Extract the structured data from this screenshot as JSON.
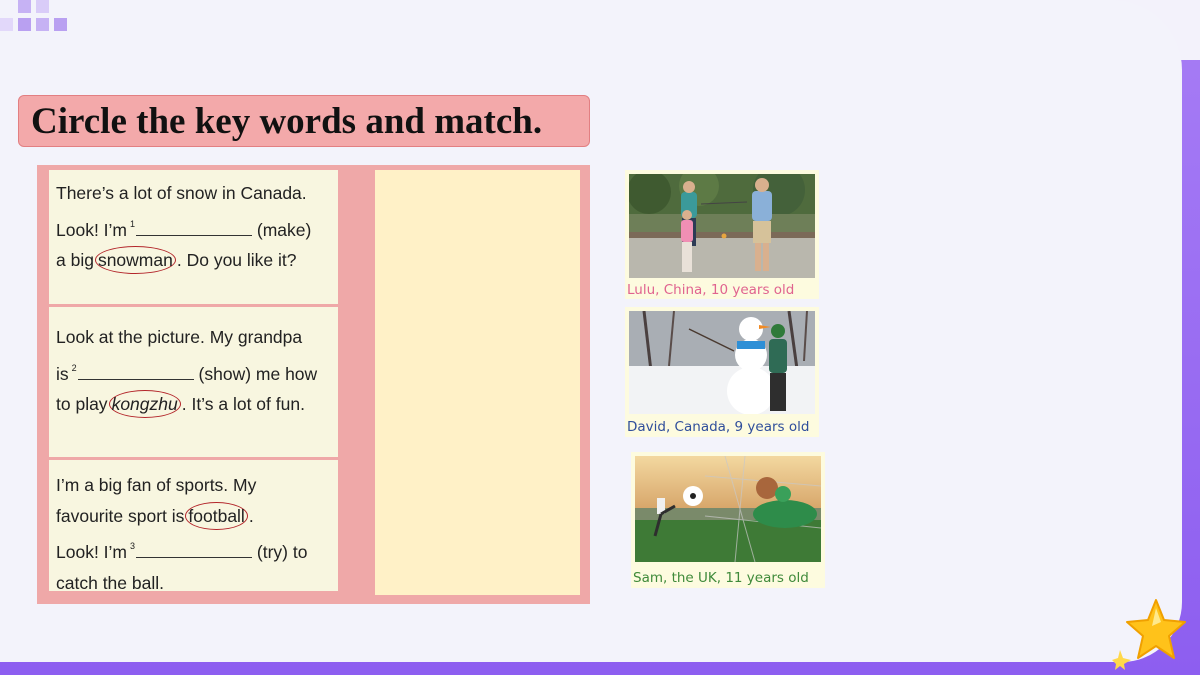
{
  "title": "Circle the key words and match.",
  "paragraphs": [
    {
      "line1": "There’s a lot of snow in Canada.",
      "line2_before": "Look! I’m",
      "number": "1",
      "line2_after": "(make)",
      "line3_before": "a big",
      "key_word": "snowman",
      "line3_after": ". Do you like it?"
    },
    {
      "line1": "Look at the picture. My grandpa",
      "line2_before": "is",
      "number": "2",
      "line2_after": "(show) me how",
      "line3_before": "to play",
      "key_word": "kongzhu",
      "line3_after": ". It’s a lot of fun."
    },
    {
      "line1": "I’m a big fan of sports. My",
      "line2_before": "favourite sport is",
      "key_word": "football",
      "line2_after": ".",
      "line3_before": "Look! I’m",
      "number": "3",
      "line3_after": "(try) to",
      "line4": "catch the ball."
    }
  ],
  "cards": [
    {
      "caption": "Lulu, China, 10 years old",
      "caption_color": "#e0638f",
      "icon": "family-kongzhu-photo"
    },
    {
      "caption": "David, Canada, 9 years old",
      "caption_color": "#2f4e9b",
      "icon": "snowman-photo"
    },
    {
      "caption": "Sam, the UK, 11 years old",
      "caption_color": "#3f8a3a",
      "icon": "football-goalkeeper-photo"
    }
  ],
  "colors": {
    "title_bg": "#f3a9aa",
    "panel_bg": "#efa8a8",
    "paragraph_bg": "#f8f6e0",
    "answer_bg": "#fff1c7",
    "circle": "#b3262b",
    "frame": "#8d5ef0"
  }
}
